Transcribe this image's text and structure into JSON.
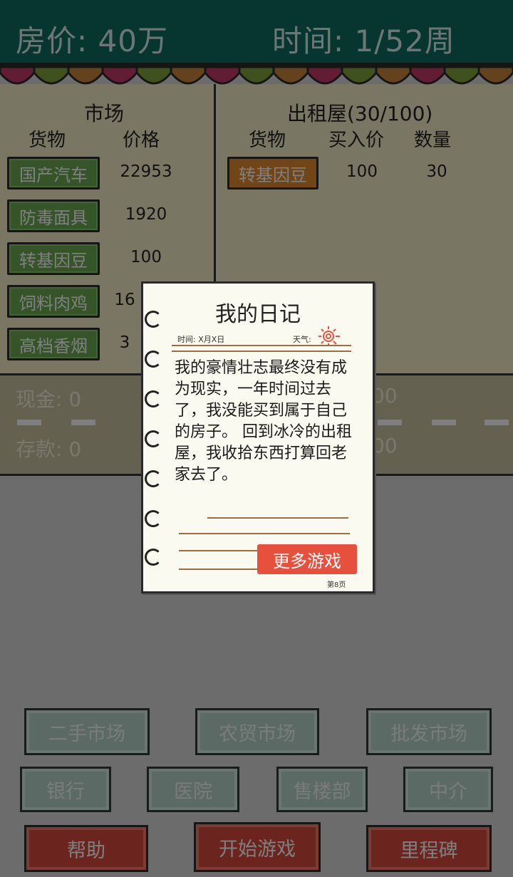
{
  "header": {
    "price_label": "房价: 40万",
    "time_label": "时间: 1/52周"
  },
  "market": {
    "title": "市场",
    "col_goods": "货物",
    "col_price": "价格",
    "items": [
      {
        "name": "国产汽车",
        "price": "22953"
      },
      {
        "name": "防毒面具",
        "price": "1920"
      },
      {
        "name": "转基因豆",
        "price": "100"
      },
      {
        "name": "饲料肉鸡",
        "price": "16"
      },
      {
        "name": "高档香烟",
        "price": "3"
      }
    ]
  },
  "rental": {
    "title": "出租屋(30/100)",
    "col_goods": "货物",
    "col_buy": "买入价",
    "col_qty": "数量",
    "items": [
      {
        "name": "转基因豆",
        "buy": "100",
        "qty": "30"
      }
    ]
  },
  "status": {
    "cash": "现金: 0",
    "deposit": "存款: 0",
    "right_top": "00",
    "right_bottom": "00"
  },
  "buttons": {
    "row1": [
      "二手市场",
      "农贸市场",
      "批发市场"
    ],
    "row2": [
      "银行",
      "医院",
      "售楼部",
      "中介"
    ],
    "row3": [
      "帮助",
      "开始游戏",
      "里程碑"
    ]
  },
  "diary": {
    "title": "我的日记",
    "time_label": "时间: X月X日",
    "weather_label": "天气:",
    "body": "我的豪情壮志最终没有成为现实，一年时间过去了，我没能买到属于自己的房子。 回到冰冷的出租屋，我收拾东西打算回老家去了。",
    "more_games": "更多游戏",
    "page": "第8页"
  },
  "colors": {
    "header": "#0f6d60",
    "panel": "#f2efc8",
    "green_button": "#6aa84f",
    "orange_button": "#e38a2c",
    "red_button": "#d94b3c",
    "teal_button": "#b6d4c9",
    "more_games": "#e8503e"
  }
}
